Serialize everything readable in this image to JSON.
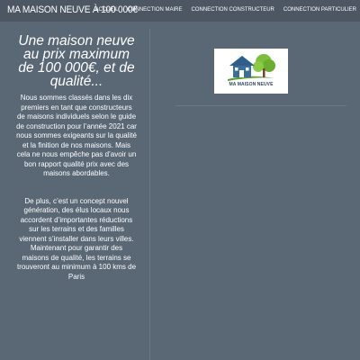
{
  "header": {
    "brand": "MA MAISON NEUVE À 100 000€",
    "nav": [
      {
        "label": "ACCUEIL"
      },
      {
        "label": "CONNECTION MAIRE"
      },
      {
        "label": "CONNECTION CONSTRUCTEUR"
      },
      {
        "label": "CONNECTION PARTICULIER"
      }
    ]
  },
  "main": {
    "headline": "Une maison neuve au prix maximum de 100 000€, et de qualité...",
    "paragraphs": [
      "Nous sommes classés dans les dix premiers en tant que constructeurs de maisons individuels selon le guide de construction pour l’année 2021 car nous sommes exigeants sur la qualité et la finition de nos maisons. Mais cela ne nous empêche pas d’avoir un bon rapport qualité prix avec des maisons abordables.",
      "De plus, c’est un concept nouvel génération, des élus locaux nous accordent d’importantes réductions sur les terrains et des familles viennent s’installer dans leurs villes. Maintenant pour garantir des maisons de qualité, les terrains se trouveront au minimum à 100 kms de Paris"
    ]
  },
  "sidebar": {
    "logo_text": "MA MAISON NEUVE",
    "logo_icon": "house-tree-icon",
    "colors": {
      "roof": "#2e5f8a",
      "house": "#3a6f9c",
      "tree": "#7bbf3a",
      "ground": "#5aa02c"
    }
  },
  "colors": {
    "background": "#5a6775",
    "topbar": "#4d5763",
    "text": "#ffffff"
  }
}
